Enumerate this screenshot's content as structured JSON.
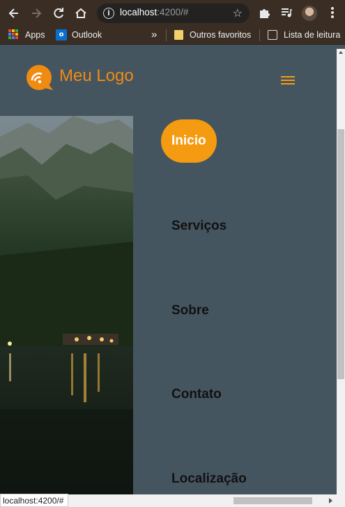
{
  "browser": {
    "url_host": "localhost",
    "url_rest": ":4200/#",
    "bookmarks": {
      "apps": "Apps",
      "outlook": "Outlook",
      "overflow": "»",
      "outros_favoritos": "Outros favoritos",
      "lista_de_leitura": "Lista de leitura"
    },
    "status_text": "localhost:4200/#"
  },
  "header": {
    "logo_text": "Meu Logo",
    "accent_color": "#f59b12"
  },
  "menu": {
    "items": [
      {
        "label": "Inicio",
        "active": true
      },
      {
        "label": "Serviços",
        "active": false
      },
      {
        "label": "Sobre",
        "active": false
      },
      {
        "label": "Contato",
        "active": false
      },
      {
        "label": "Localização",
        "active": false
      }
    ]
  },
  "icons": {
    "back": "arrow-left-icon",
    "forward": "arrow-right-icon",
    "reload": "reload-icon",
    "home": "home-icon",
    "info": "info-icon",
    "star": "star-icon",
    "extensions": "puzzle-icon",
    "media": "media-icon",
    "menu": "kebab-menu-icon",
    "hamburger": "hamburger-icon"
  }
}
